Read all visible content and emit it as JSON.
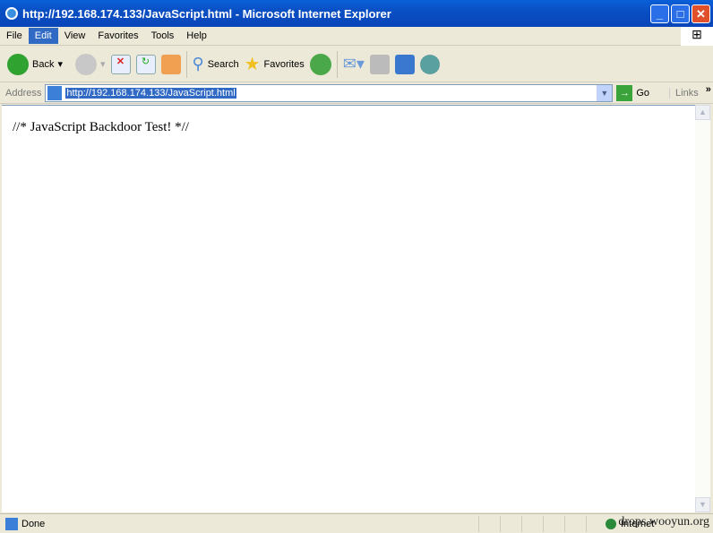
{
  "window": {
    "title": "http://192.168.174.133/JavaScript.html - Microsoft Internet Explorer",
    "minimize": "_",
    "maximize": "□",
    "close": "✕"
  },
  "menu": [
    "File",
    "Edit",
    "View",
    "Favorites",
    "Tools",
    "Help"
  ],
  "toolbar": {
    "back": "Back",
    "search": "Search",
    "favorites": "Favorites"
  },
  "address": {
    "label": "Address",
    "url": "http://192.168.174.133/JavaScript.html",
    "go": "Go",
    "links": "Links",
    "more": "»"
  },
  "page": {
    "text": "//* JavaScript Backdoor Test! *//"
  },
  "status": {
    "text": "Done",
    "zone": "Internet",
    "watermark": "drops.wooyun.org"
  }
}
